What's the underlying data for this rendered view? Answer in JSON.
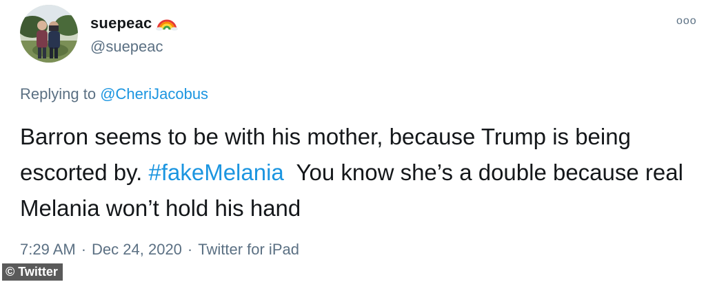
{
  "user": {
    "display_name": "suepeac",
    "name_emoji_icon": "rainbow-icon",
    "handle": "@suepeac",
    "avatar_icon": "profile-photo"
  },
  "more_menu": {
    "icon": "more-options-icon",
    "glyph": "ooo"
  },
  "reply": {
    "prefix": "Replying to",
    "mention": "@CheriJacobus"
  },
  "tweet": {
    "text_before_hashtag": "Barron seems to be with his mother, because Trump is being escorted by. ",
    "hashtag": "#fakeMelania",
    "text_after_hashtag": "  You know she’s a double because real Melania won’t hold his hand"
  },
  "meta": {
    "time": "7:29 AM",
    "separator1": "·",
    "date": "Dec 24, 2020",
    "separator2": "·",
    "source": "Twitter for iPad"
  },
  "watermark": {
    "text": "© Twitter"
  },
  "colors": {
    "link": "#1b95e0",
    "secondary_text": "#5b7083",
    "primary_text": "#14171a"
  }
}
